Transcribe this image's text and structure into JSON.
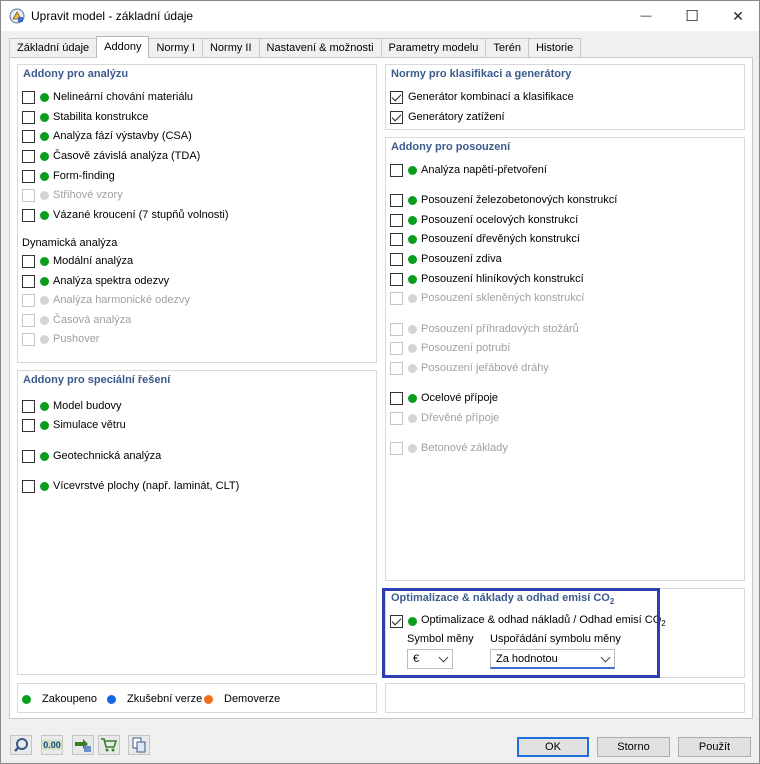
{
  "window": {
    "title": "Upravit model - základní údaje",
    "minimize_glyph": "—",
    "maximize_glyph": "☐",
    "close_glyph": "✕"
  },
  "tabs": [
    {
      "label": "Základní údaje",
      "active": false
    },
    {
      "label": "Addony",
      "active": true
    },
    {
      "label": "Normy I",
      "active": false
    },
    {
      "label": "Normy II",
      "active": false
    },
    {
      "label": "Nastavení & možnosti",
      "active": false
    },
    {
      "label": "Parametry modelu",
      "active": false
    },
    {
      "label": "Terén",
      "active": false
    },
    {
      "label": "Historie",
      "active": false
    }
  ],
  "analysis": {
    "title": "Addony pro analýzu",
    "items": [
      {
        "label": "Nelineární chování materiálu",
        "enabled": true,
        "checked": false
      },
      {
        "label": "Stabilita konstrukce",
        "enabled": true,
        "checked": false
      },
      {
        "label": "Analýza fází výstavby (CSA)",
        "enabled": true,
        "checked": false
      },
      {
        "label": "Časově závislá analýza (TDA)",
        "enabled": true,
        "checked": false
      },
      {
        "label": "Form-finding",
        "enabled": true,
        "checked": false
      },
      {
        "label": "Střihové vzory",
        "enabled": false,
        "checked": false
      },
      {
        "label": "Vázané kroucení (7 stupňů volnosti)",
        "enabled": true,
        "checked": false
      }
    ],
    "dynamic_title": "Dynamická analýza",
    "dynamic_items": [
      {
        "label": "Modální analýza",
        "enabled": true,
        "checked": false
      },
      {
        "label": "Analýza spektra odezvy",
        "enabled": true,
        "checked": false
      },
      {
        "label": "Analýza harmonické odezvy",
        "enabled": false,
        "checked": false
      },
      {
        "label": "Časová analýza",
        "enabled": false,
        "checked": false
      },
      {
        "label": "Pushover",
        "enabled": false,
        "checked": false
      }
    ]
  },
  "special": {
    "title": "Addony pro speciální řešení",
    "items": [
      {
        "label": "Model budovy",
        "enabled": true,
        "checked": false
      },
      {
        "label": "Simulace větru",
        "enabled": true,
        "checked": false
      },
      {
        "label": "Geotechnická analýza",
        "enabled": true,
        "checked": false
      },
      {
        "label": "Vícevrstvé plochy (např. laminát, CLT)",
        "enabled": true,
        "checked": false
      }
    ]
  },
  "norms": {
    "title": "Normy pro klasifikaci a generátory",
    "items": [
      {
        "label": "Generátor kombinací a klasifikace",
        "checked": true
      },
      {
        "label": "Generátory zatížení",
        "checked": true
      }
    ]
  },
  "design": {
    "title": "Addony pro posouzení",
    "items": [
      {
        "label": "Analýza napětí-přetvoření",
        "enabled": true,
        "checked": false
      },
      {
        "label": "Posouzení železobetonových konstrukcí",
        "enabled": true,
        "checked": false
      },
      {
        "label": "Posouzení ocelových konstrukcí",
        "enabled": true,
        "checked": false
      },
      {
        "label": "Posouzení dřevěných konstrukcí",
        "enabled": true,
        "checked": false
      },
      {
        "label": "Posouzení zdiva",
        "enabled": true,
        "checked": false
      },
      {
        "label": "Posouzení hliníkových konstrukcí",
        "enabled": true,
        "checked": false
      },
      {
        "label": "Posouzení skleněných konstrukcí",
        "enabled": false,
        "checked": false
      },
      {
        "label": "Posouzení příhradových stožárů",
        "enabled": false,
        "checked": false
      },
      {
        "label": "Posouzení potrubí",
        "enabled": false,
        "checked": false
      },
      {
        "label": "Posouzení jeřábové dráhy",
        "enabled": false,
        "checked": false
      },
      {
        "label": "Ocelové přípoje",
        "enabled": true,
        "checked": false
      },
      {
        "label": "Dřevěné přípoje",
        "enabled": false,
        "checked": false
      },
      {
        "label": "Betonové základy",
        "enabled": false,
        "checked": false
      }
    ]
  },
  "optimization": {
    "title": "Optimalizace & náklady a odhad emisí CO",
    "title_sub": "2",
    "item_label": "Optimalizace & odhad nákladů / Odhad emisí CO",
    "item_sub": "2",
    "item_checked": true,
    "currency_label": "Symbol měny",
    "currency_value": "€",
    "placement_label": "Uspořádání symbolu měny",
    "placement_value": "Za hodnotou"
  },
  "legend": {
    "purchased": "Zakoupeno",
    "trial": "Zkušební verze",
    "demo": "Demoverze"
  },
  "buttons": {
    "ok": "OK",
    "cancel": "Storno",
    "apply": "Použít"
  },
  "toolbar": {
    "units_text": "0.00"
  },
  "colors": {
    "purchased": "#0a9e1e",
    "trial": "#1565e8",
    "demo": "#f36c1d",
    "disabled": "#d4d4d4",
    "panel_title": "#3a5a8c",
    "highlight": "#2c3fb0"
  }
}
